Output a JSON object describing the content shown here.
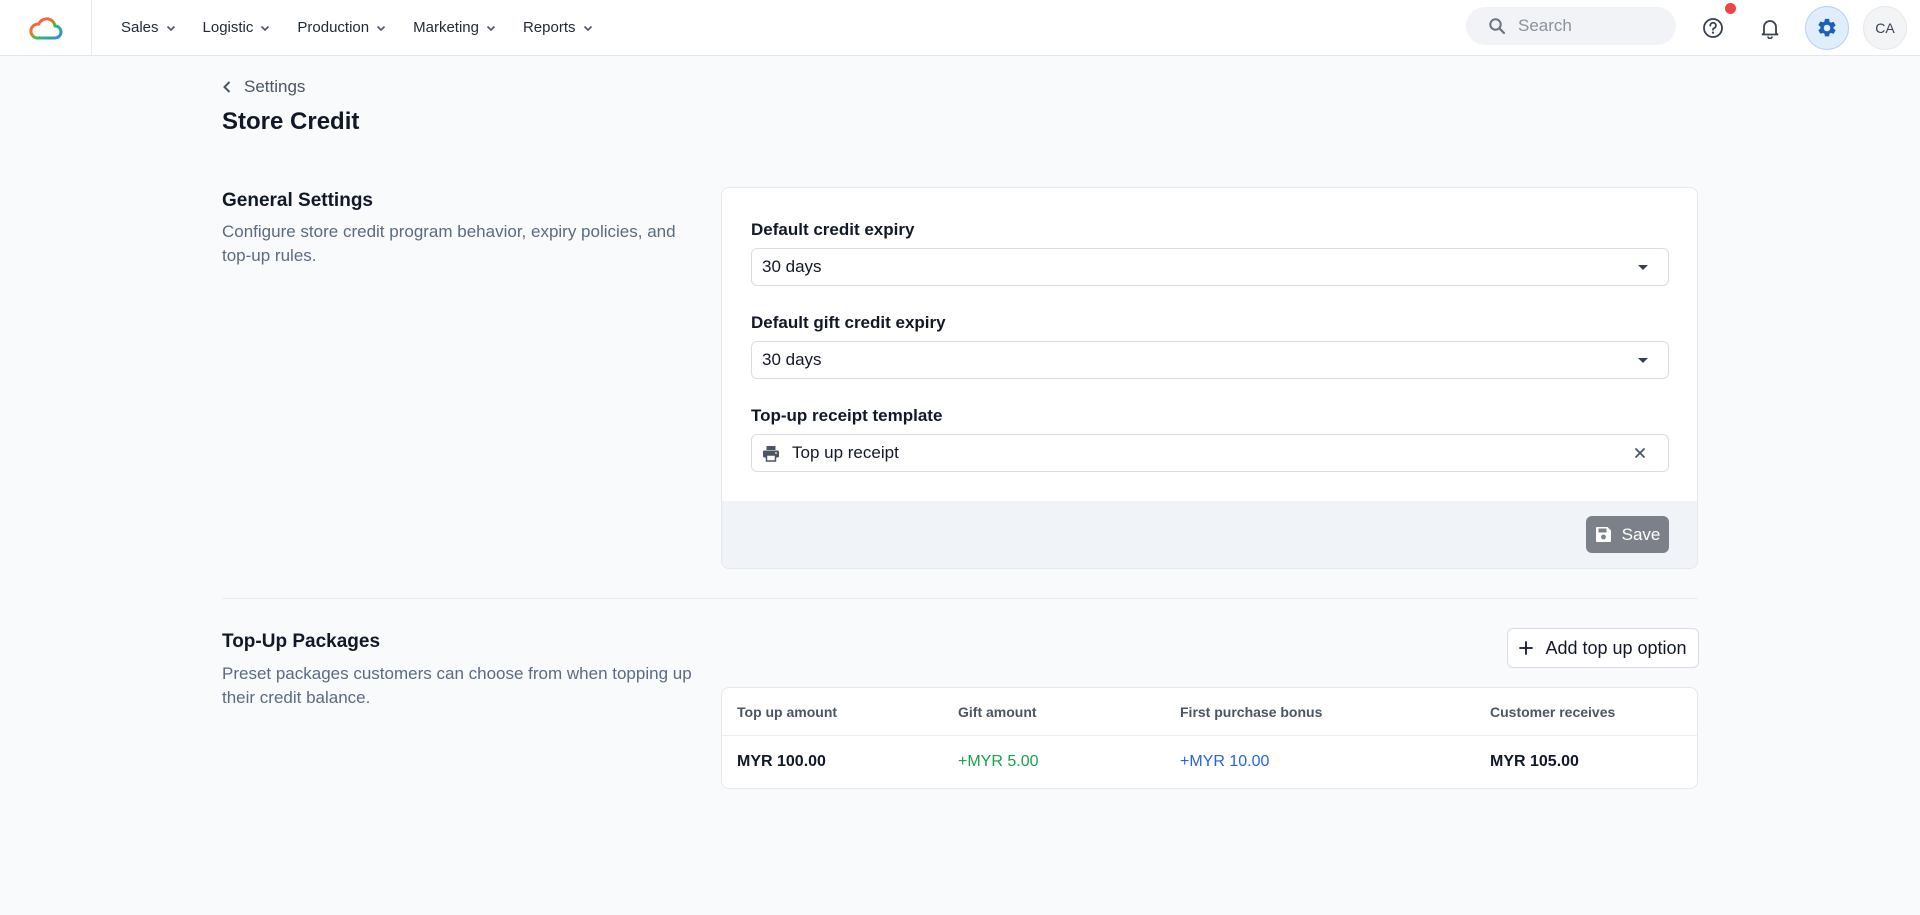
{
  "nav": {
    "items": [
      {
        "label": "Sales"
      },
      {
        "label": "Logistic"
      },
      {
        "label": "Production"
      },
      {
        "label": "Marketing"
      },
      {
        "label": "Reports"
      }
    ],
    "search_placeholder": "Search",
    "avatar_initials": "CA"
  },
  "breadcrumb": {
    "label": "Settings"
  },
  "page": {
    "title": "Store Credit"
  },
  "general": {
    "title": "General Settings",
    "description": "Configure store credit program behavior, expiry policies, and top-up rules.",
    "fields": {
      "credit_expiry": {
        "label": "Default credit expiry",
        "value": "30 days"
      },
      "gift_expiry": {
        "label": "Default gift credit expiry",
        "value": "30 days"
      },
      "receipt_template": {
        "label": "Top-up receipt template",
        "value": "Top up receipt"
      }
    },
    "save_label": "Save"
  },
  "packages": {
    "title": "Top-Up Packages",
    "description": "Preset packages customers can choose from when topping up their credit balance.",
    "add_label": "Add top up option",
    "columns": [
      "Top up amount",
      "Gift amount",
      "First purchase bonus",
      "Customer receives"
    ],
    "rows": [
      {
        "top_up": "MYR 100.00",
        "gift": "+MYR 5.00",
        "bonus": "+MYR 10.00",
        "receives": "MYR 105.00"
      }
    ]
  },
  "colors": {
    "accent": "#2563eb",
    "gift_green": "#16a34a",
    "notification_red": "#ef4444",
    "save_disabled": "#7c8089"
  }
}
